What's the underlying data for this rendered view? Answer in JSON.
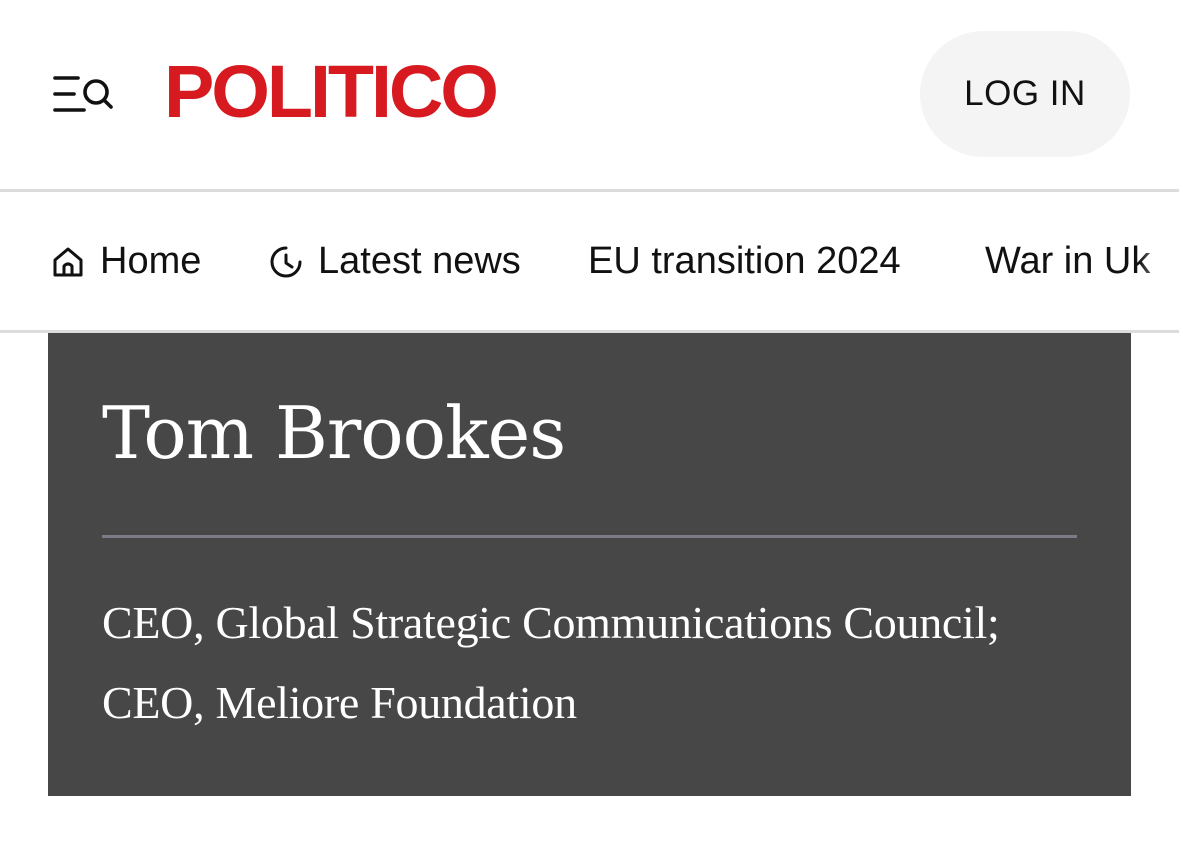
{
  "header": {
    "logo_text": "POLITICO",
    "login_label": "LOG IN",
    "menu_icon": "menu-search-icon",
    "brand_color": "#d71920"
  },
  "nav": {
    "items": [
      {
        "label": "Home",
        "icon": "home-icon"
      },
      {
        "label": "Latest news",
        "icon": "clock-icon"
      },
      {
        "label": "EU transition 2024"
      },
      {
        "label": "War in Uk"
      }
    ]
  },
  "author": {
    "name": "Tom Brookes",
    "title_line1": "CEO, Global Strategic Communications Council;",
    "title_line2": "CEO, Meliore Foundation",
    "panel_color": "#474747"
  }
}
